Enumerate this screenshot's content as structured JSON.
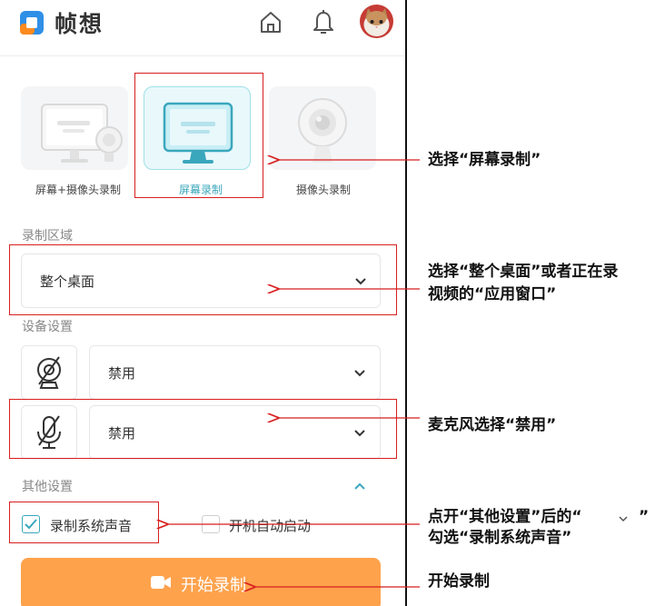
{
  "header": {
    "app_title": "帧想",
    "icons": [
      "home-icon",
      "bell-icon",
      "avatar"
    ]
  },
  "modes": {
    "items": [
      {
        "label": "屏幕+摄像头录制",
        "icon": "screen-camera-icon",
        "active": false
      },
      {
        "label": "屏幕录制",
        "icon": "monitor-icon",
        "active": true
      },
      {
        "label": "摄像头录制",
        "icon": "webcam-icon",
        "active": false
      }
    ]
  },
  "record_area": {
    "label": "录制区域",
    "value": "整个桌面"
  },
  "device": {
    "label": "设备设置",
    "camera": {
      "icon": "camera-disabled-icon",
      "value": "禁用"
    },
    "mic": {
      "icon": "mic-disabled-icon",
      "value": "禁用"
    }
  },
  "other": {
    "label": "其他设置",
    "record_system_audio": {
      "label": "录制系统声音",
      "checked": true
    },
    "auto_start": {
      "label": "开机自动启动",
      "checked": false
    }
  },
  "start_button": {
    "label": "开始录制",
    "icon": "video-camera-icon"
  },
  "annotations": {
    "a1": "选择“屏幕录制”",
    "a2_line1": "选择“整个桌面”或者正在录",
    "a2_line2": "视频的“应用窗口”",
    "a3": "麦克风选择“禁用”",
    "a4_line1": "点开“其他设置”后的“",
    "a4_line1_end": "”",
    "a4_line2": "勾选“录制系统声音”",
    "a5": "开始录制"
  },
  "colors": {
    "accent": "#3aa7bd",
    "start_button": "#fea24c",
    "annotation_red": "#d81e1e",
    "logo_blue": "#2f8fe6",
    "logo_orange": "#ff8a1f"
  }
}
